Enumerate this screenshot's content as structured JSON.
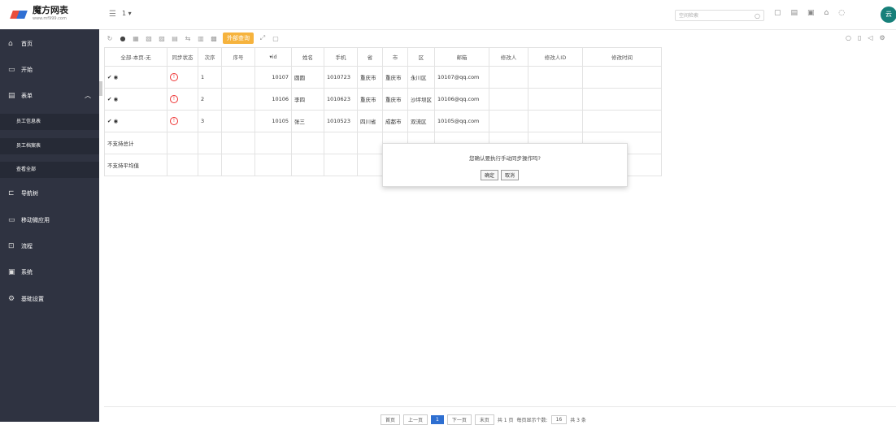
{
  "logo": {
    "title": "魔方网表",
    "subtitle": "www.mf999.com"
  },
  "topbar": {
    "page_selector": "1 ▾",
    "search_placeholder": "空间检索",
    "avatar_text": "云"
  },
  "sidebar": {
    "items": [
      {
        "label": "首页"
      },
      {
        "label": "开始"
      },
      {
        "label": "表单"
      },
      {
        "label": "员工信息表"
      },
      {
        "label": "员工档案表"
      },
      {
        "label": "查看全部"
      },
      {
        "label": "导航树"
      },
      {
        "label": "移动微应用"
      },
      {
        "label": "流程"
      },
      {
        "label": "系统"
      },
      {
        "label": "基础设置"
      }
    ]
  },
  "toolbar": {
    "external_query": "外部查询"
  },
  "table": {
    "headers": [
      "全部-本页-无",
      "同步状态",
      "次序",
      "序号",
      "▾id",
      "姓名",
      "手机",
      "省",
      "市",
      "区",
      "邮箱",
      "修改人",
      "修改人ID",
      "修改时间"
    ],
    "rows": [
      {
        "order": "1",
        "id": "10107",
        "name": "圆圆",
        "phone": "1010723",
        "province": "重庆市",
        "city": "重庆市",
        "district": "永川区",
        "email": "10107@qq.com"
      },
      {
        "order": "2",
        "id": "10106",
        "name": "李四",
        "phone": "1010623",
        "province": "重庆市",
        "city": "重庆市",
        "district": "沙坪坝区",
        "email": "10106@qq.com"
      },
      {
        "order": "3",
        "id": "10105",
        "name": "张三",
        "phone": "1010523",
        "province": "四川省",
        "city": "成都市",
        "district": "双流区",
        "email": "10105@qq.com"
      }
    ],
    "footer": [
      "不支持总计",
      "不支持平均值"
    ]
  },
  "modal": {
    "message": "您确认要执行手动同步操作吗?",
    "ok": "确定",
    "cancel": "取消"
  },
  "pager": {
    "first": "首页",
    "prev": "上一页",
    "current": "1",
    "next": "下一页",
    "last": "末页",
    "total_pages": "共 1 页",
    "per_page_label": "每页显示个数:",
    "per_page": "16",
    "total_records": "共 3 条"
  }
}
